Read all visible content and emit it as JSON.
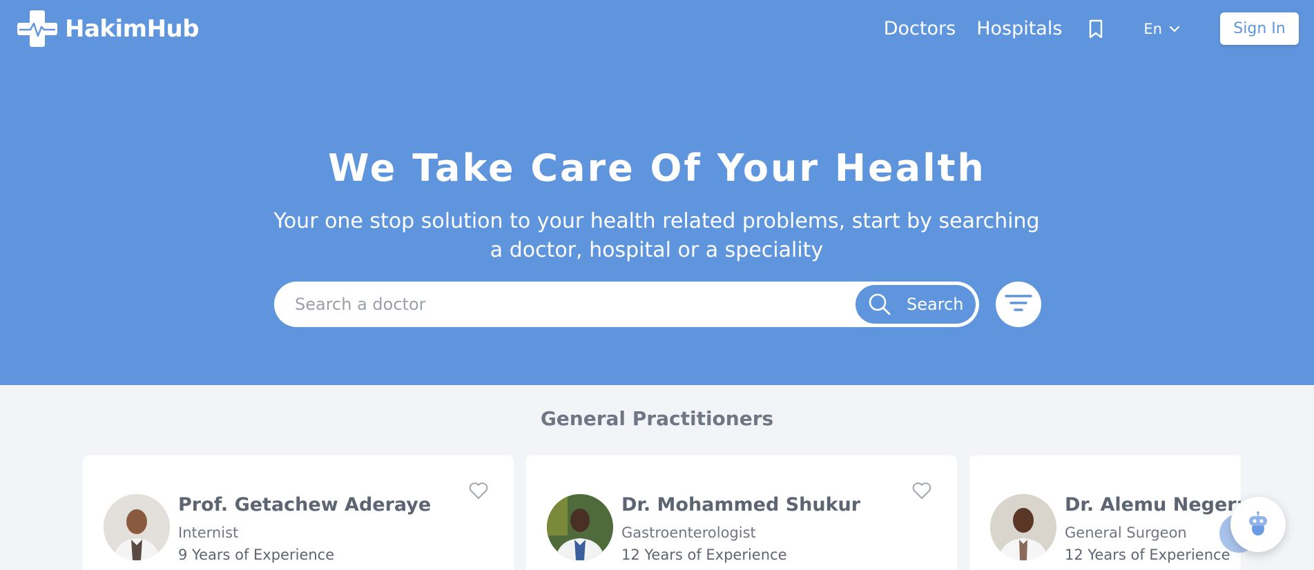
{
  "brand": {
    "name": "HakimHub",
    "logo_icon": "medical-cross-pulse-icon"
  },
  "nav": {
    "links": [
      "Doctors",
      "Hospitals"
    ],
    "bookmark_icon": "bookmark-icon",
    "language": "En",
    "signin_label": "Sign In"
  },
  "hero": {
    "title": "We Take Care Of Your Health",
    "subtitle": "Your one stop solution to your health related problems, start by searching a doctor, hospital or a speciality",
    "search": {
      "placeholder": "Search a doctor",
      "value": "",
      "button_label": "Search"
    },
    "filter_icon": "filter-icon"
  },
  "section": {
    "title": "General Practitioners",
    "doctors": [
      {
        "name": "Prof. Getachew Aderaye",
        "specialty": "Internist",
        "experience": "9 Years of Experience"
      },
      {
        "name": "Dr. Mohammed Shukur",
        "specialty": "Gastroenterologist",
        "experience": "12 Years of Experience"
      },
      {
        "name": "Dr. Alemu Negera",
        "specialty": "General Surgeon",
        "experience": "12 Years of Experience"
      }
    ]
  },
  "colors": {
    "primary": "#5f95dd",
    "background": "#f2f4f8",
    "text": "#5d6472"
  }
}
